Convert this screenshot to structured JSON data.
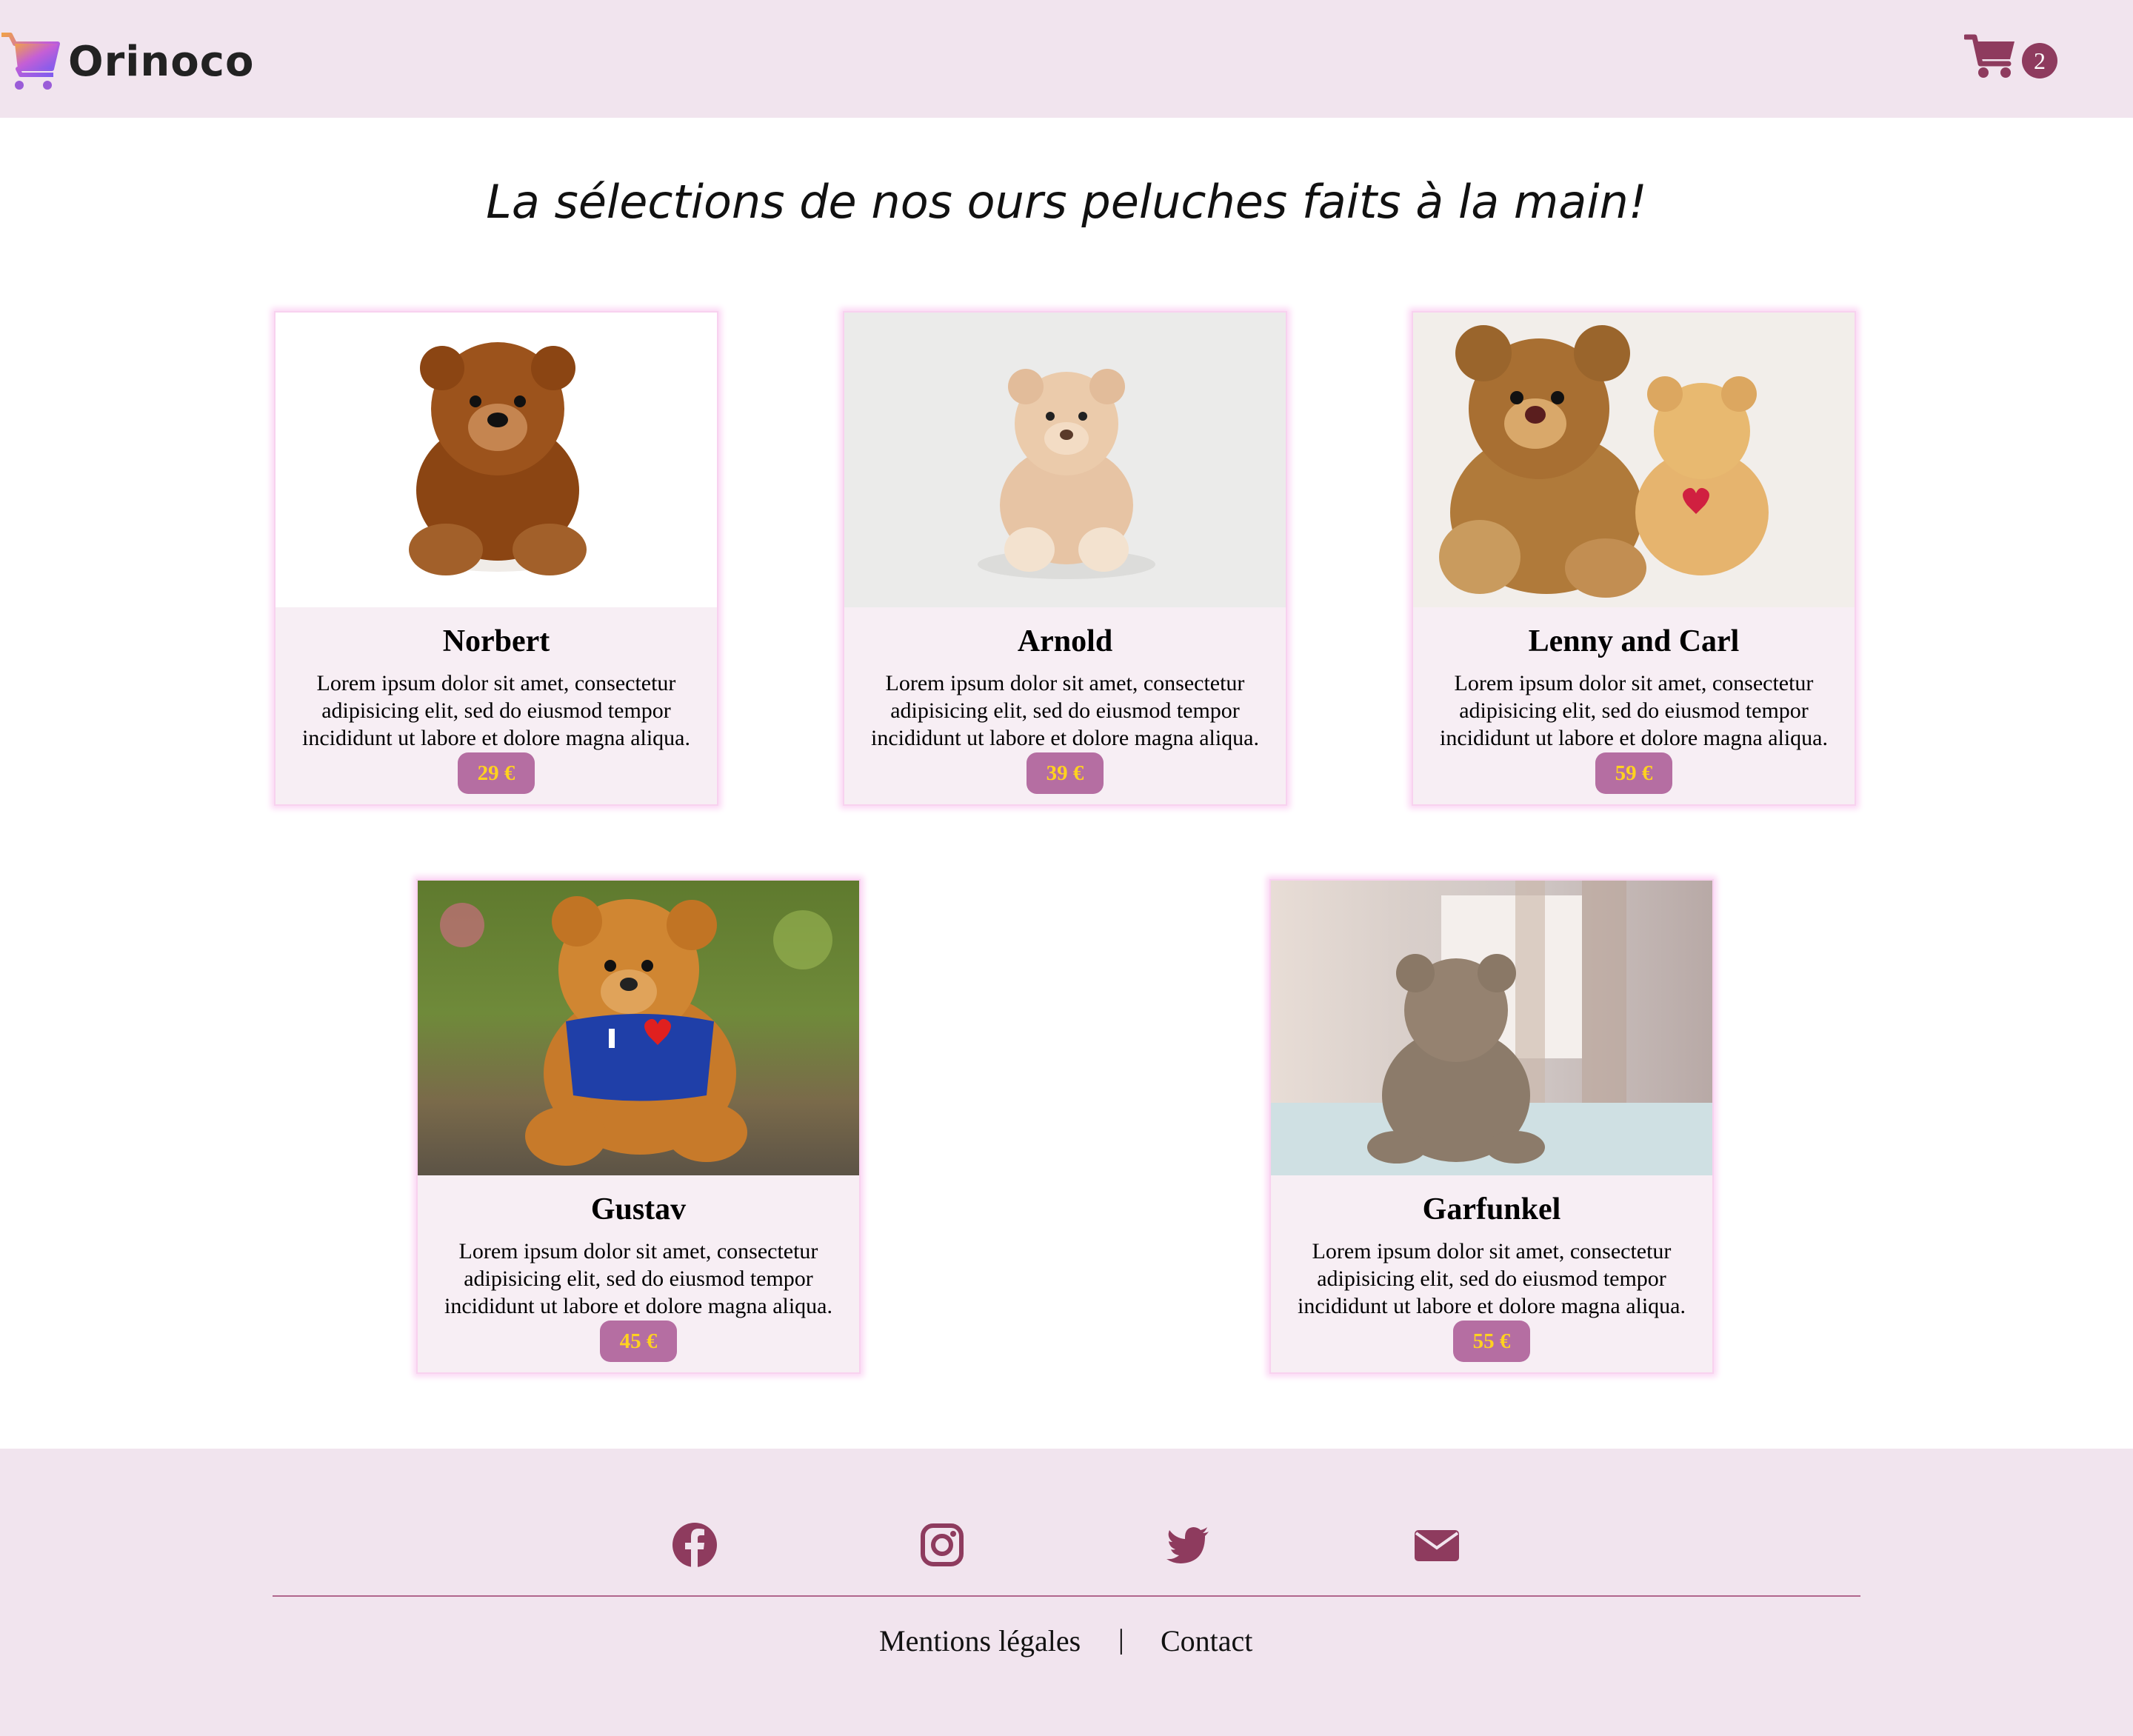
{
  "brand": {
    "name": "Orinoco"
  },
  "cart": {
    "count": "2"
  },
  "page_title": "La sélections de nos ours peluches faits à la main!",
  "products": [
    {
      "name": "Norbert",
      "description": "Lorem ipsum dolor sit amet, consectetur adipisicing elit, sed do eiusmod tempor incididunt ut labore et dolore magna aliqua.",
      "price": "29 €"
    },
    {
      "name": "Arnold",
      "description": "Lorem ipsum dolor sit amet, consectetur adipisicing elit, sed do eiusmod tempor incididunt ut labore et dolore magna aliqua.",
      "price": "39 €"
    },
    {
      "name": "Lenny and Carl",
      "description": "Lorem ipsum dolor sit amet, consectetur adipisicing elit, sed do eiusmod tempor incididunt ut labore et dolore magna aliqua.",
      "price": "59 €"
    },
    {
      "name": "Gustav",
      "description": "Lorem ipsum dolor sit amet, consectetur adipisicing elit, sed do eiusmod tempor incididunt ut labore et dolore magna aliqua.",
      "price": "45 €"
    },
    {
      "name": "Garfunkel",
      "description": "Lorem ipsum dolor sit amet, consectetur adipisicing elit, sed do eiusmod tempor incididunt ut labore et dolore magna aliqua.",
      "price": "55 €"
    }
  ],
  "footer": {
    "social_icons": [
      "facebook-icon",
      "instagram-icon",
      "twitter-icon",
      "envelope-icon"
    ],
    "links": {
      "legal": "Mentions légales",
      "separator": "|",
      "contact": "Contact"
    }
  },
  "colors": {
    "header_bg": "#f1e4ee",
    "accent": "#8e3b5e",
    "price_bg": "#b56ea2",
    "price_text": "#ffd21f"
  }
}
